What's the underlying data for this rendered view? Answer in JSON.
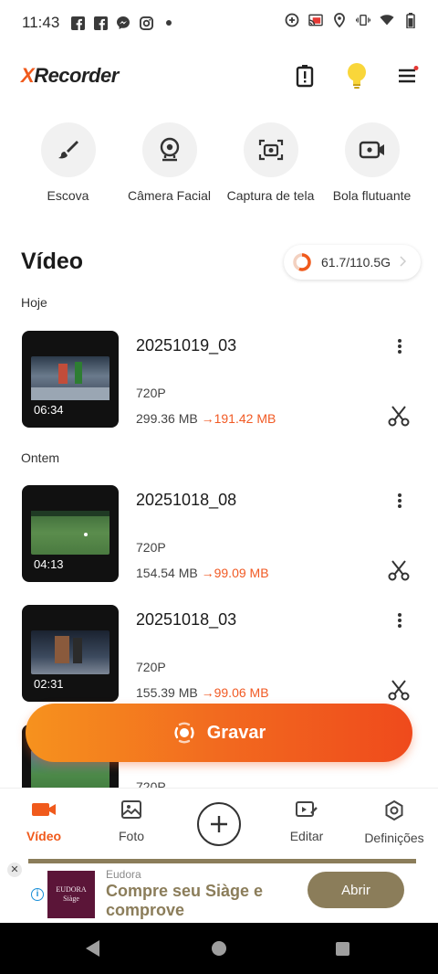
{
  "status_bar": {
    "time": "11:43",
    "left_icons": [
      "facebook-icon",
      "facebook-icon",
      "messenger-icon",
      "instagram-icon",
      "dot-icon"
    ],
    "right_icons": [
      "data-saver-icon",
      "cast-icon",
      "location-icon",
      "vibrate-icon",
      "wifi-icon",
      "battery-icon"
    ]
  },
  "header": {
    "logo_x": "X",
    "logo_rest": "Recorder",
    "icons": [
      "battery-alert-icon",
      "bulb-icon",
      "menu-icon"
    ],
    "accent": "#f05a1c"
  },
  "tools": [
    {
      "label": "Escova",
      "icon": "brush-icon"
    },
    {
      "label": "Câmera Facial",
      "icon": "webcam-icon"
    },
    {
      "label": "Captura de tela",
      "icon": "screenshot-icon"
    },
    {
      "label": "Bola flutuante",
      "icon": "floating-camera-icon"
    }
  ],
  "video_section": {
    "title": "Vídeo",
    "storage": "61.7/110.5G",
    "storage_used_fraction": 0.558
  },
  "groups": [
    {
      "day": "Hoje",
      "videos": [
        {
          "name": "20251019_03",
          "duration": "06:34",
          "resolution": "720P",
          "original_size": "299.36 MB",
          "arrow": "→",
          "compressed_size": "191.42 MB"
        }
      ]
    },
    {
      "day": "Ontem",
      "videos": [
        {
          "name": "20251018_08",
          "duration": "04:13",
          "resolution": "720P",
          "original_size": "154.54 MB",
          "arrow": "→",
          "compressed_size": "99.09 MB"
        },
        {
          "name": "20251018_03",
          "duration": "02:31",
          "resolution": "720P",
          "original_size": "155.39 MB",
          "arrow": "→",
          "compressed_size": "99.06 MB"
        },
        {
          "name": "",
          "duration": "",
          "resolution": "720P",
          "original_size": "",
          "arrow": "",
          "compressed_size": ""
        }
      ]
    }
  ],
  "record_button": {
    "label": "Gravar"
  },
  "bottom_nav": [
    {
      "label": "Vídeo",
      "icon": "video-icon",
      "active": true
    },
    {
      "label": "Foto",
      "icon": "photo-icon",
      "active": false
    },
    {
      "label": "",
      "icon": "add-icon",
      "active": false
    },
    {
      "label": "Editar",
      "icon": "edit-icon",
      "active": false
    },
    {
      "label": "Definições",
      "icon": "settings-icon",
      "active": false
    }
  ],
  "ad": {
    "close": "✕",
    "info": "i",
    "logo_line1": "EUDORA",
    "logo_line2": "Siàge",
    "brand": "Eudora",
    "text": "Compre seu Siàge e comprove",
    "button": "Abrir"
  }
}
